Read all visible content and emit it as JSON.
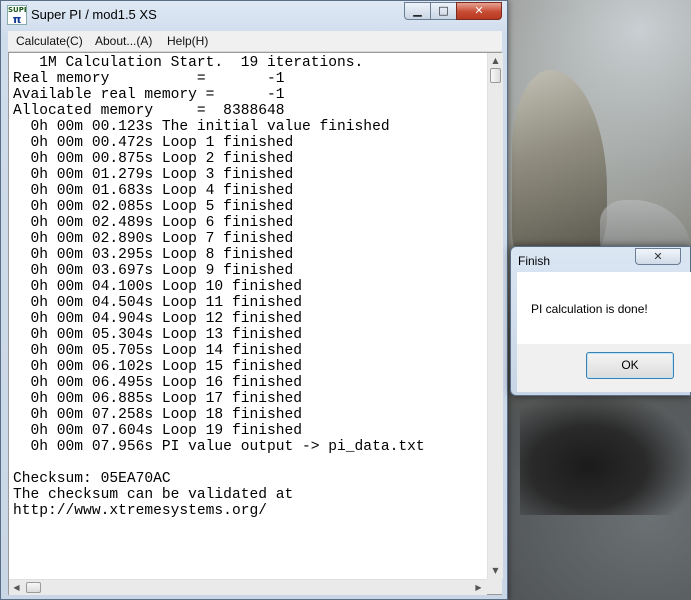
{
  "window": {
    "title": "Super PI / mod1.5 XS",
    "icon_text_top": "SUPER",
    "icon_text_pi": "π",
    "buttons": {
      "minimize": "▁",
      "maximize": "□",
      "close": "✕"
    }
  },
  "menu": {
    "calculate": "Calculate(C)",
    "about": "About...(A)",
    "help": "Help(H)"
  },
  "console_lines": [
    "   1M Calculation Start.  19 iterations.",
    "Real memory          =       -1",
    "Available real memory =      -1",
    "Allocated memory     =  8388648",
    "  0h 00m 00.123s The initial value finished",
    "  0h 00m 00.472s Loop 1 finished",
    "  0h 00m 00.875s Loop 2 finished",
    "  0h 00m 01.279s Loop 3 finished",
    "  0h 00m 01.683s Loop 4 finished",
    "  0h 00m 02.085s Loop 5 finished",
    "  0h 00m 02.489s Loop 6 finished",
    "  0h 00m 02.890s Loop 7 finished",
    "  0h 00m 03.295s Loop 8 finished",
    "  0h 00m 03.697s Loop 9 finished",
    "  0h 00m 04.100s Loop 10 finished",
    "  0h 00m 04.504s Loop 11 finished",
    "  0h 00m 04.904s Loop 12 finished",
    "  0h 00m 05.304s Loop 13 finished",
    "  0h 00m 05.705s Loop 14 finished",
    "  0h 00m 06.102s Loop 15 finished",
    "  0h 00m 06.495s Loop 16 finished",
    "  0h 00m 06.885s Loop 17 finished",
    "  0h 00m 07.258s Loop 18 finished",
    "  0h 00m 07.604s Loop 19 finished",
    "  0h 00m 07.956s PI value output -> pi_data.txt",
    "",
    "Checksum: 05EA70AC",
    "The checksum can be validated at",
    "http://www.xtremesystems.org/"
  ],
  "scrollbar": {
    "up": "▲",
    "down": "▼",
    "left": "◀",
    "right": "▶"
  },
  "dialog": {
    "title": "Finish",
    "close": "✕",
    "message": "PI calculation is done!",
    "ok_label": "OK"
  }
}
